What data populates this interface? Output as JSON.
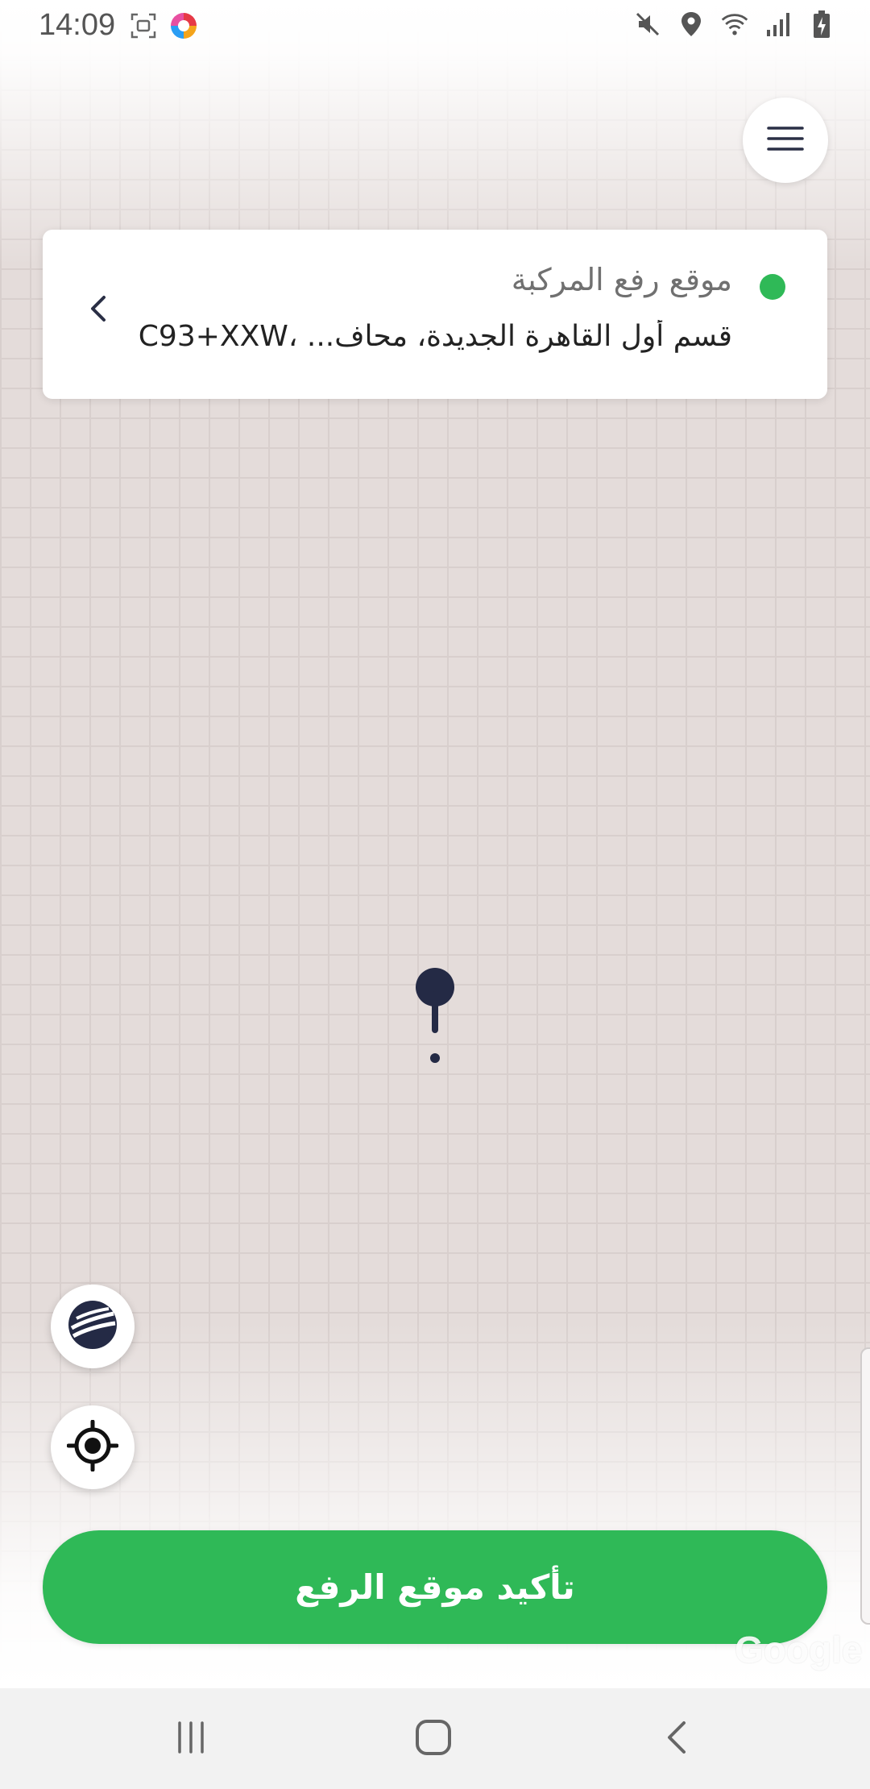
{
  "status_bar": {
    "time": "14:09",
    "left_icons": [
      "screenshot-icon",
      "app-color-icon"
    ],
    "right_icons": [
      "mute-icon",
      "location-icon",
      "wifi-icon",
      "signal-icon",
      "battery-charging-icon"
    ]
  },
  "header": {
    "menu_icon": "hamburger-menu-icon"
  },
  "location_card": {
    "title": "موقع رفع المركبة",
    "address": "قسم أول القاهرة الجديدة، محاف... ،2C93+XXW",
    "status_color": "#2fb957"
  },
  "map": {
    "pin_icon": "map-pin-icon",
    "layers_icon": "map-layers-icon",
    "locate_icon": "my-location-icon",
    "attribution": "Google"
  },
  "actions": {
    "confirm_label": "تأكيد موقع الرفع",
    "accent_color": "#2fb957"
  },
  "nav_bar": {
    "recent_icon": "recent-apps-icon",
    "home_icon": "home-icon",
    "back_icon": "back-icon"
  }
}
